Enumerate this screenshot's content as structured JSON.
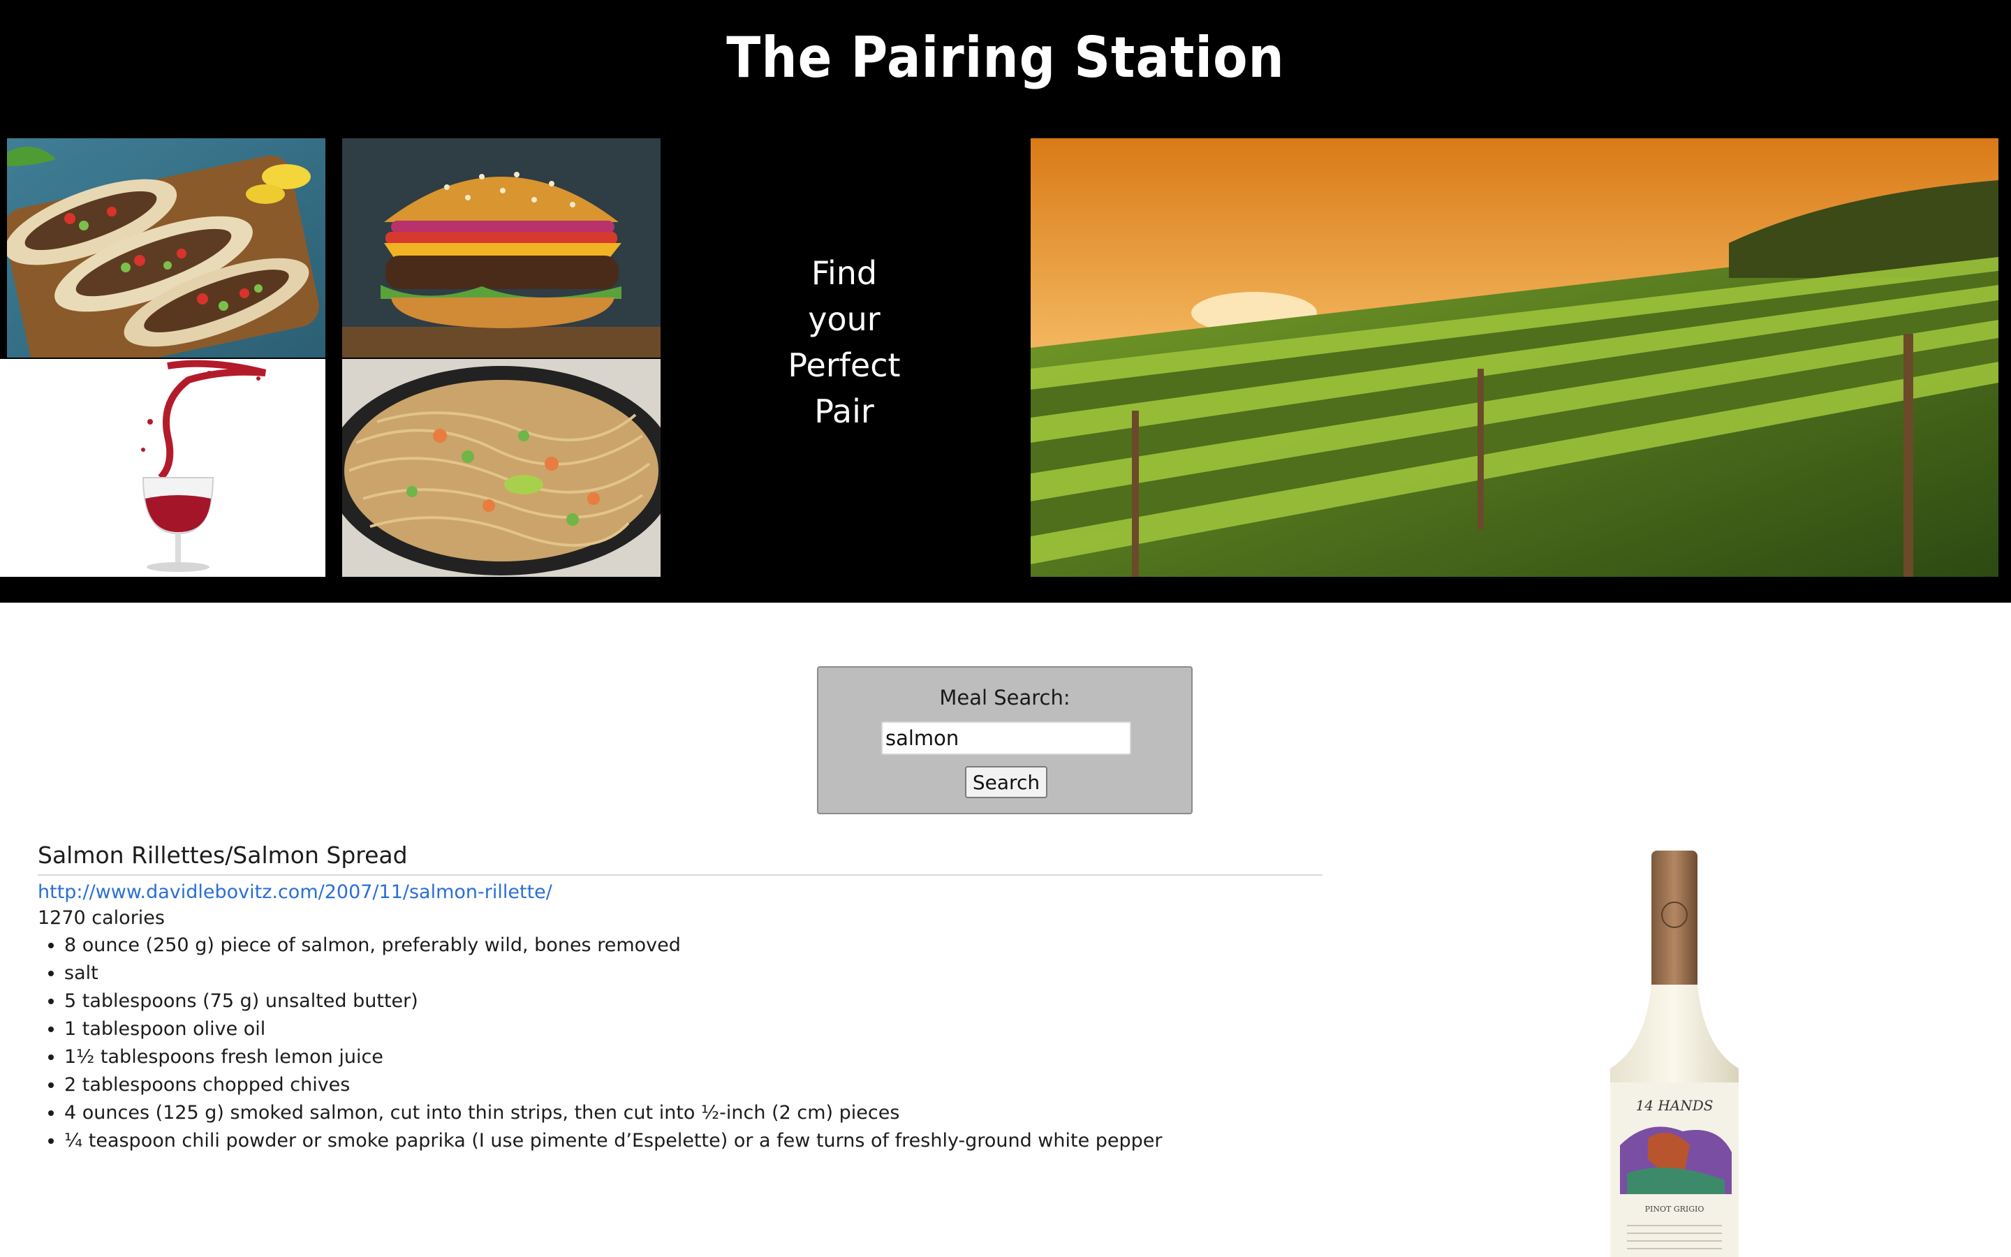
{
  "header": {
    "title": "The Pairing Station"
  },
  "hero": {
    "images": [
      {
        "name": "tacos-photo"
      },
      {
        "name": "burger-photo"
      },
      {
        "name": "red-wine-glass-photo"
      },
      {
        "name": "noodles-photo"
      },
      {
        "name": "vineyard-photo"
      }
    ],
    "tagline": [
      "Find",
      "your",
      "Perfect",
      "Pair"
    ]
  },
  "search": {
    "label": "Meal Search:",
    "value": "salmon",
    "button_label": "Search"
  },
  "result": {
    "title": "Salmon Rillettes/Salmon Spread",
    "url": "http://www.davidlebovitz.com/2007/11/salmon-rillette/",
    "calories": "1270 calories",
    "ingredients": [
      "8 ounce (250 g) piece of salmon, preferably wild, bones removed",
      "salt",
      "5 tablespoons (75 g) unsalted butter)",
      "1 tablespoon olive oil",
      "1½ tablespoons fresh lemon juice",
      "2 tablespoons chopped chives",
      "4 ounces (125 g) smoked salmon, cut into thin strips, then cut into ½-inch (2 cm) pieces",
      "¼ teaspoon chili powder or smoke paprika (I use pimente d’Espelette) or a few turns of freshly-ground white pepper"
    ]
  },
  "wine": {
    "label_brand": "14 HANDS",
    "label_varietal": "PINOT GRIGIO"
  }
}
